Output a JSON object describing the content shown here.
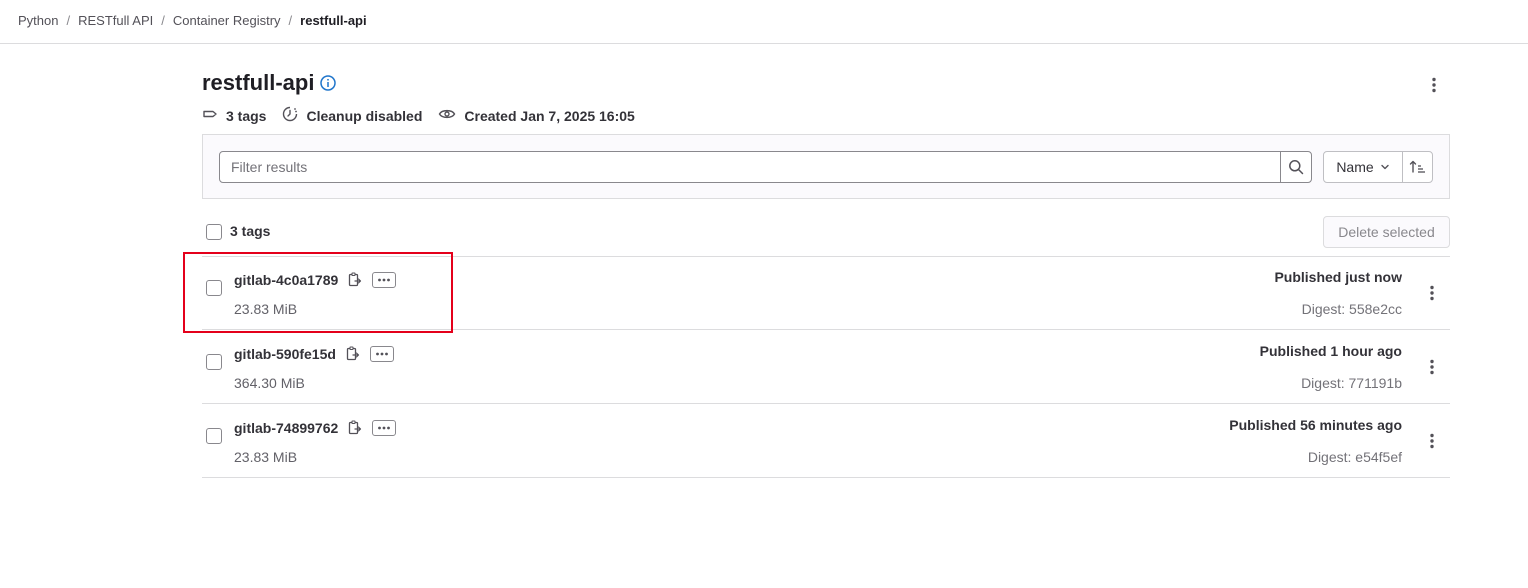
{
  "breadcrumb": [
    {
      "label": "Python"
    },
    {
      "label": "RESTfull API"
    },
    {
      "label": "Container Registry"
    },
    {
      "label": "restfull-api"
    }
  ],
  "repository": {
    "name": "restfull-api",
    "tags_count": "3 tags",
    "cleanup": "Cleanup disabled",
    "created": "Created Jan 7, 2025 16:05"
  },
  "filter": {
    "placeholder": "Filter results",
    "sort_label": "Name"
  },
  "list": {
    "select_all_label": "3 tags",
    "delete_label": "Delete selected",
    "rows": [
      {
        "name": "gitlab-4c0a1789",
        "size": "23.83 MiB",
        "published": "Published just now",
        "digest": "Digest: 558e2cc"
      },
      {
        "name": "gitlab-590fe15d",
        "size": "364.30 MiB",
        "published": "Published 1 hour ago",
        "digest": "Digest: 771191b"
      },
      {
        "name": "gitlab-74899762",
        "size": "23.83 MiB",
        "published": "Published 56 minutes ago",
        "digest": "Digest: e54f5ef"
      }
    ]
  },
  "colors": {
    "accent": "#1f75cb",
    "highlight": "#e4001b",
    "border": "#dcdcde"
  },
  "icons": [
    "info-icon",
    "tag-icon",
    "cleanup-icon",
    "eye-icon",
    "kebab-icon",
    "search-icon",
    "chevron-down-icon",
    "sort-ascending-icon",
    "copy-icon",
    "ellipsis-icon"
  ]
}
